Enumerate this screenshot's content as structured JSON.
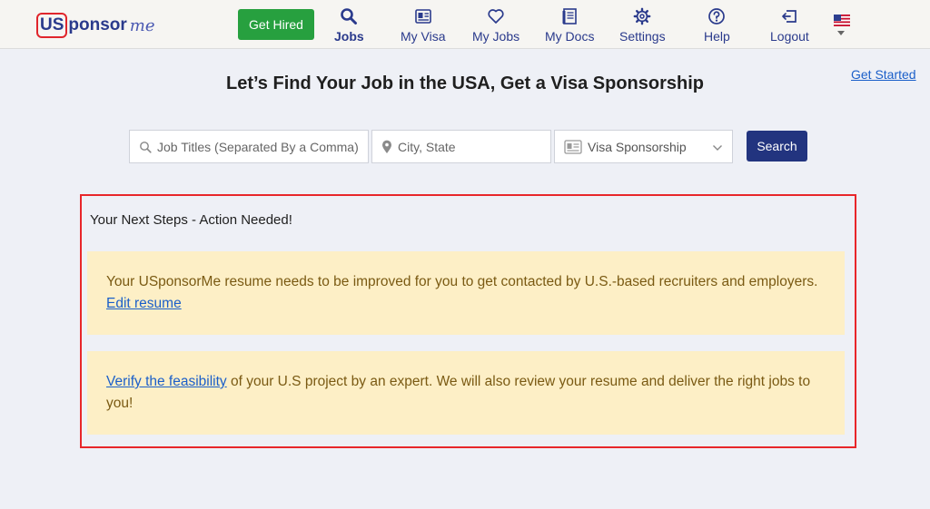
{
  "brand": {
    "logo_us": "US",
    "logo_sponsor": "ponsor",
    "logo_me": "me"
  },
  "nav": {
    "get_hired": "Get Hired",
    "items": [
      {
        "label": "Jobs",
        "icon": "search-icon"
      },
      {
        "label": "My Visa",
        "icon": "id-card-icon"
      },
      {
        "label": "My Jobs",
        "icon": "heart-icon"
      },
      {
        "label": "My Docs",
        "icon": "document-icon"
      },
      {
        "label": "Settings",
        "icon": "gear-icon"
      },
      {
        "label": "Help",
        "icon": "help-icon"
      },
      {
        "label": "Logout",
        "icon": "logout-icon"
      }
    ],
    "language_flag": "us-flag-icon"
  },
  "header": {
    "title": "Let’s Find Your Job in the USA, Get a Visa Sponsorship",
    "get_started": "Get Started"
  },
  "search": {
    "job_placeholder": "Job Titles (Separated By a Comma)",
    "location_placeholder": "City, State",
    "visa_selected": "Visa Sponsorship",
    "button_label": "Search"
  },
  "next_steps": {
    "title": "Your Next Steps - Action Needed!",
    "alert1_text": "Your USponsorMe resume needs to be improved for you to get contacted by U.S.-based recruiters and employers. ",
    "alert1_link": "Edit resume",
    "alert2_link": "Verify the feasibility",
    "alert2_text": " of your U.S project by an expert. We will also review your resume and deliver the right jobs to you!"
  },
  "colors": {
    "brand_blue": "#2a3a8c",
    "get_hired_green": "#27a03f",
    "search_button": "#22347f",
    "alert_bg": "#fdefc6",
    "alert_text": "#7a5a13",
    "link": "#1b5fc9",
    "highlight_border": "#e8262a"
  }
}
